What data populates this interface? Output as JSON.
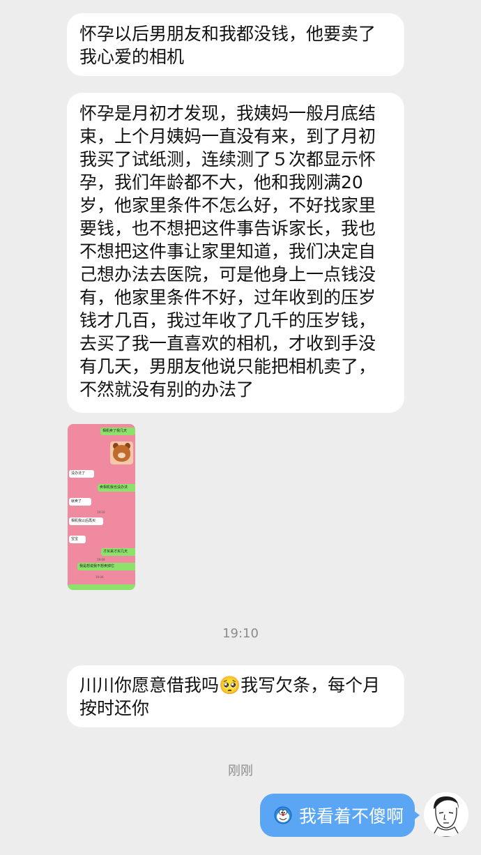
{
  "messages": [
    {
      "side": "left",
      "text": "怀孕以后男朋友和我都没钱，他要卖了\n我心爱的相机"
    },
    {
      "side": "left",
      "text": "怀孕是月初才发现，我姨妈一般月底结\n束，上个月姨妈一直没有来，到了月初\n我买了试纸测，连续测了５次都显示怀\n孕，我们年龄都不大，他和我刚满20\n岁，他家里条件不怎么好，不好找家里\n要钱，也不想把这件事告诉家长，我也\n不想把这件事让家里知道，我们决定自\n己想办法去医院，可是他身上一点钱没\n有，他家里条件不好，过年收到的压岁\n钱才几百，我过年收了几千的压岁钱，\n去买了我一直喜欢的相机，才收到手没\n有几天，男朋友他说只能把相机卖了，\n不然就没有别的办法了"
    },
    {
      "side": "left",
      "text": "川川你愿意借我吗🥺我写欠条，每个月\n按时还你"
    },
    {
      "side": "right",
      "text": "我看着不傻啊"
    }
  ],
  "timestamps": [
    "19:10",
    "刚刚"
  ],
  "embedded_image": {
    "bubbles": [
      {
        "type": "g",
        "text": "相机卖了我几天"
      },
      {
        "type": "w",
        "text": "没办法了"
      },
      {
        "type": "g",
        "text": "卖相机我也没办法"
      },
      {
        "type": "w",
        "text": "就卖了"
      },
      {
        "type": "w",
        "text": "相机我以后再买"
      },
      {
        "type": "w",
        "text": "宝宝"
      },
      {
        "type": "g",
        "text": "才买来才买几天"
      },
      {
        "type": "g",
        "text": "我是想说我不想卖掉它"
      }
    ],
    "times": [
      "19:10",
      "19:09",
      "19:04"
    ]
  },
  "colors": {
    "background": "#ededed",
    "incoming": "#ffffff",
    "outgoing": "#5aa6f5",
    "embed_bg": "#f08aa0"
  }
}
